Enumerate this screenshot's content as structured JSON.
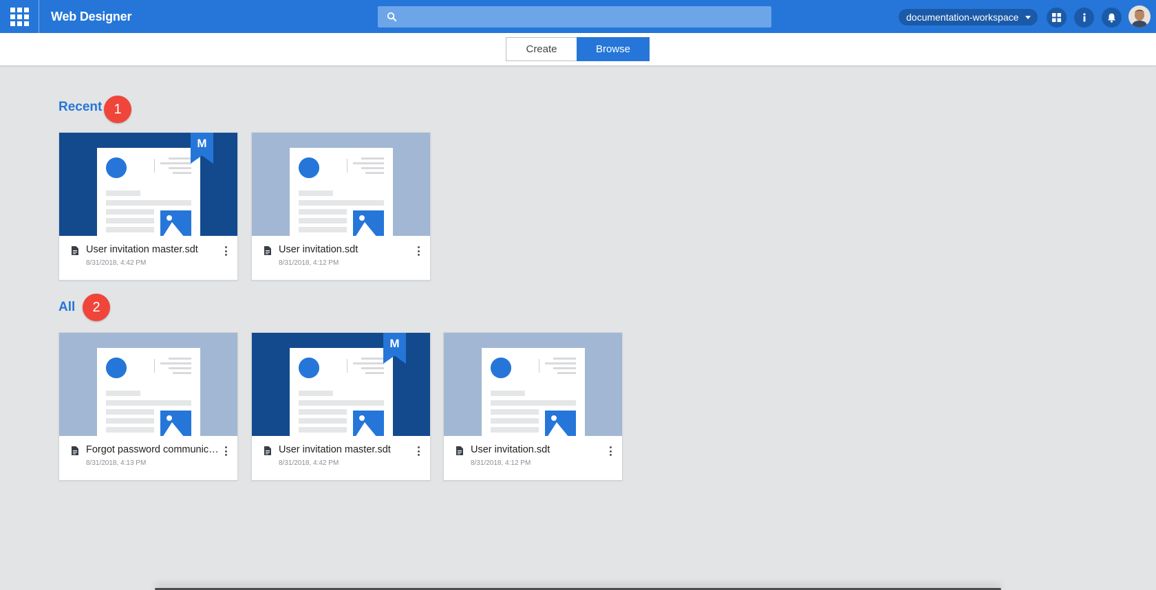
{
  "app": {
    "title": "Web Designer"
  },
  "search": {
    "placeholder": ""
  },
  "header": {
    "workspace": "documentation-workspace"
  },
  "tabs": {
    "create": "Create",
    "browse": "Browse",
    "active": "Browse"
  },
  "sections": {
    "recent": {
      "title": "Recent",
      "badge": "1",
      "cards": [
        {
          "title": "User invitation master.sdt",
          "date": "8/31/2018, 4:42 PM",
          "master": true,
          "master_label": "M"
        },
        {
          "title": "User invitation.sdt",
          "date": "8/31/2018, 4:12 PM",
          "master": false
        }
      ]
    },
    "all": {
      "title": "All",
      "badge": "2",
      "cards": [
        {
          "title": "Forgot password communicat...",
          "date": "8/31/2018, 4:13 PM",
          "master": false
        },
        {
          "title": "User invitation master.sdt",
          "date": "8/31/2018, 4:42 PM",
          "master": true,
          "master_label": "M"
        },
        {
          "title": "User invitation.sdt",
          "date": "8/31/2018, 4:12 PM",
          "master": false
        }
      ]
    }
  },
  "icons": [
    "apps-grid-icon",
    "search-icon",
    "chevron-down-icon",
    "dashboard-icon",
    "info-icon",
    "bell-icon",
    "file-icon",
    "more-vertical-icon",
    "image-icon"
  ],
  "colors": {
    "primary": "#2576d8",
    "dark_thumb": "#134a8d",
    "light_thumb": "#a2b7d3",
    "badge": "#f0453a",
    "background": "#e3e4e6"
  }
}
